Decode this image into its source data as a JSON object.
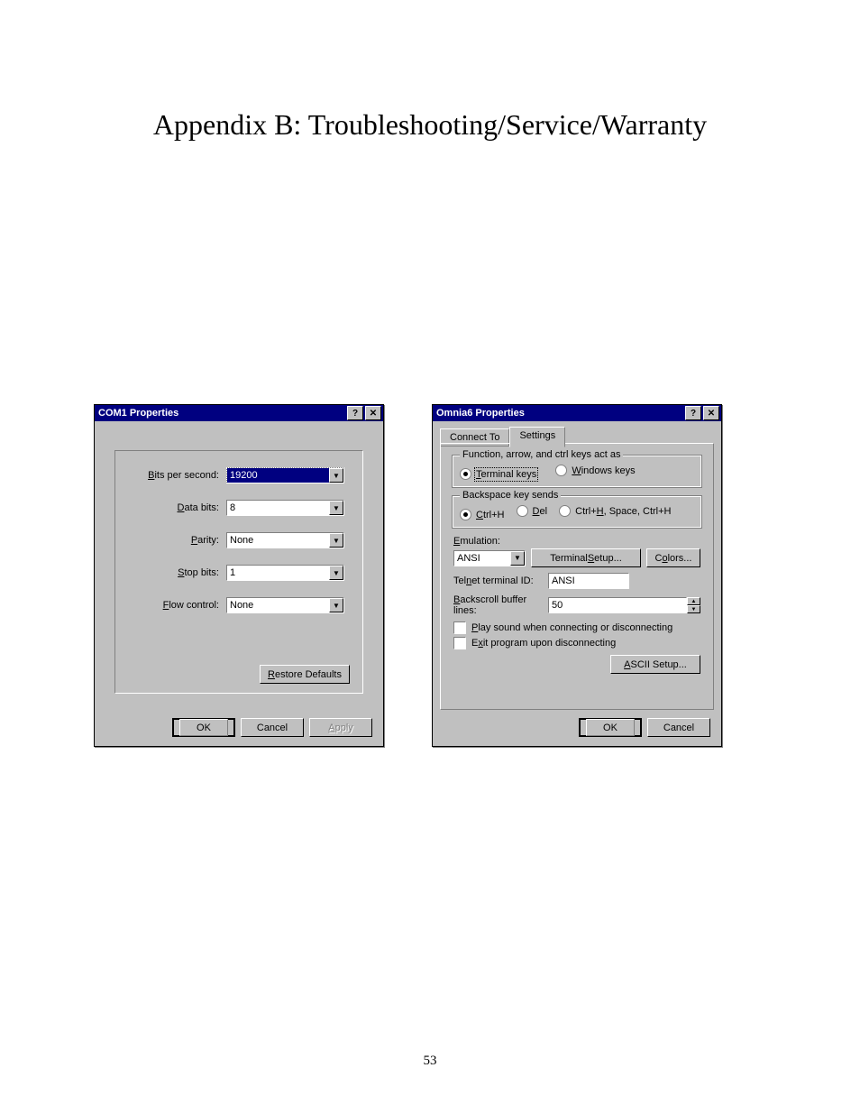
{
  "page": {
    "title": "Appendix B: Troubleshooting/Service/Warranty",
    "number": "53"
  },
  "dialog1": {
    "title": "COM1 Properties",
    "fields": {
      "bits_per_second": {
        "label_pre": "B",
        "label_post": "its per second:",
        "value": "19200"
      },
      "data_bits": {
        "label_pre": "D",
        "label_post": "ata bits:",
        "value": "8"
      },
      "parity": {
        "label_pre": "P",
        "label_post": "arity:",
        "value": "None"
      },
      "stop_bits": {
        "label_pre": "S",
        "label_post": "top bits:",
        "value": "1"
      },
      "flow_control": {
        "label_pre": "F",
        "label_post": "low control:",
        "value": "None"
      }
    },
    "restore_pre": "R",
    "restore_post": "estore Defaults",
    "ok": "OK",
    "cancel": "Cancel",
    "apply_pre": "A",
    "apply_post": "pply"
  },
  "dialog2": {
    "title": "Omnia6 Properties",
    "tabs": {
      "connect": "Connect To",
      "settings": "Settings"
    },
    "group_keys": {
      "title": "Function, arrow, and ctrl keys act as",
      "terminal_pre": "T",
      "terminal_post": "erminal keys",
      "windows_pre": "W",
      "windows_post": "indows keys"
    },
    "group_backspace": {
      "title": "Backspace key sends",
      "opt1_pre": "C",
      "opt1_post": "trl+H",
      "opt2_pre": "D",
      "opt2_post": "el",
      "opt3_pre": "",
      "opt3_mid": "Ctrl+",
      "opt3_u": "H",
      "opt3_end": ", Space, Ctrl+H"
    },
    "emulation_pre": "E",
    "emulation_post": "mulation:",
    "emulation_value": "ANSI",
    "terminal_setup_pre": "Terminal ",
    "terminal_setup_u": "S",
    "terminal_setup_post": "etup...",
    "colors_pre": "C",
    "colors_u": "o",
    "colors_post": "lors...",
    "telnet_label_pre": "Tel",
    "telnet_label_u": "n",
    "telnet_label_post": "et terminal ID:",
    "telnet_value": "ANSI",
    "backscroll_pre": "B",
    "backscroll_post": "ackscroll buffer lines:",
    "backscroll_value": "50",
    "play_sound_pre": "P",
    "play_sound_post": "lay sound when connecting or disconnecting",
    "exit_pre": "E",
    "exit_u": "x",
    "exit_post": "it program upon disconnecting",
    "ascii_pre": "A",
    "ascii_post": "SCII Setup...",
    "ok": "OK",
    "cancel": "Cancel"
  }
}
